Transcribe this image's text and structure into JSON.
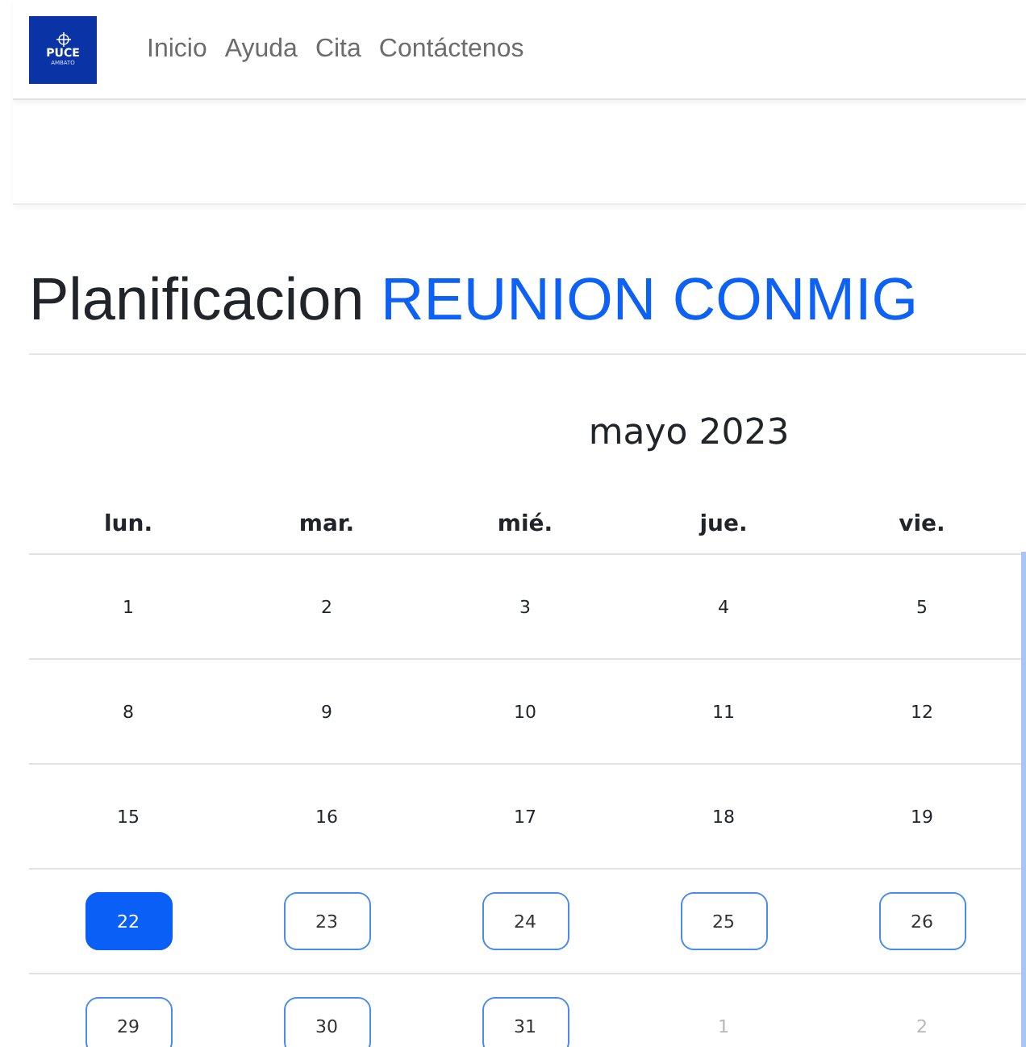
{
  "logo": {
    "title": "PUCE",
    "subtitle": "AMBATO"
  },
  "nav": [
    {
      "label": "Inicio"
    },
    {
      "label": "Ayuda"
    },
    {
      "label": "Cita"
    },
    {
      "label": "Contáctenos"
    }
  ],
  "heading": {
    "text": "Planificacion",
    "highlight": "REUNION CONMIG"
  },
  "calendar": {
    "title": "mayo 2023",
    "weekdays": [
      "lun.",
      "mar.",
      "mié.",
      "jue.",
      "vie."
    ],
    "weeks": [
      [
        {
          "day": "1",
          "kind": "past",
          "selected": false
        },
        {
          "day": "2",
          "kind": "past",
          "selected": false
        },
        {
          "day": "3",
          "kind": "past",
          "selected": false
        },
        {
          "day": "4",
          "kind": "past",
          "selected": false
        },
        {
          "day": "5",
          "kind": "past",
          "selected": false
        }
      ],
      [
        {
          "day": "8",
          "kind": "past",
          "selected": false
        },
        {
          "day": "9",
          "kind": "past",
          "selected": false
        },
        {
          "day": "10",
          "kind": "past",
          "selected": false
        },
        {
          "day": "11",
          "kind": "past",
          "selected": false
        },
        {
          "day": "12",
          "kind": "past",
          "selected": false
        }
      ],
      [
        {
          "day": "15",
          "kind": "past",
          "selected": false
        },
        {
          "day": "16",
          "kind": "past",
          "selected": false
        },
        {
          "day": "17",
          "kind": "past",
          "selected": false
        },
        {
          "day": "18",
          "kind": "past",
          "selected": false
        },
        {
          "day": "19",
          "kind": "past",
          "selected": false
        }
      ],
      [
        {
          "day": "22",
          "kind": "available",
          "selected": true
        },
        {
          "day": "23",
          "kind": "available",
          "selected": false
        },
        {
          "day": "24",
          "kind": "available",
          "selected": false
        },
        {
          "day": "25",
          "kind": "available",
          "selected": false
        },
        {
          "day": "26",
          "kind": "available",
          "selected": false
        }
      ],
      [
        {
          "day": "29",
          "kind": "available",
          "selected": false
        },
        {
          "day": "30",
          "kind": "available",
          "selected": false
        },
        {
          "day": "31",
          "kind": "available",
          "selected": false
        },
        {
          "day": "1",
          "kind": "outside",
          "selected": false
        },
        {
          "day": "2",
          "kind": "outside",
          "selected": false
        }
      ]
    ]
  }
}
